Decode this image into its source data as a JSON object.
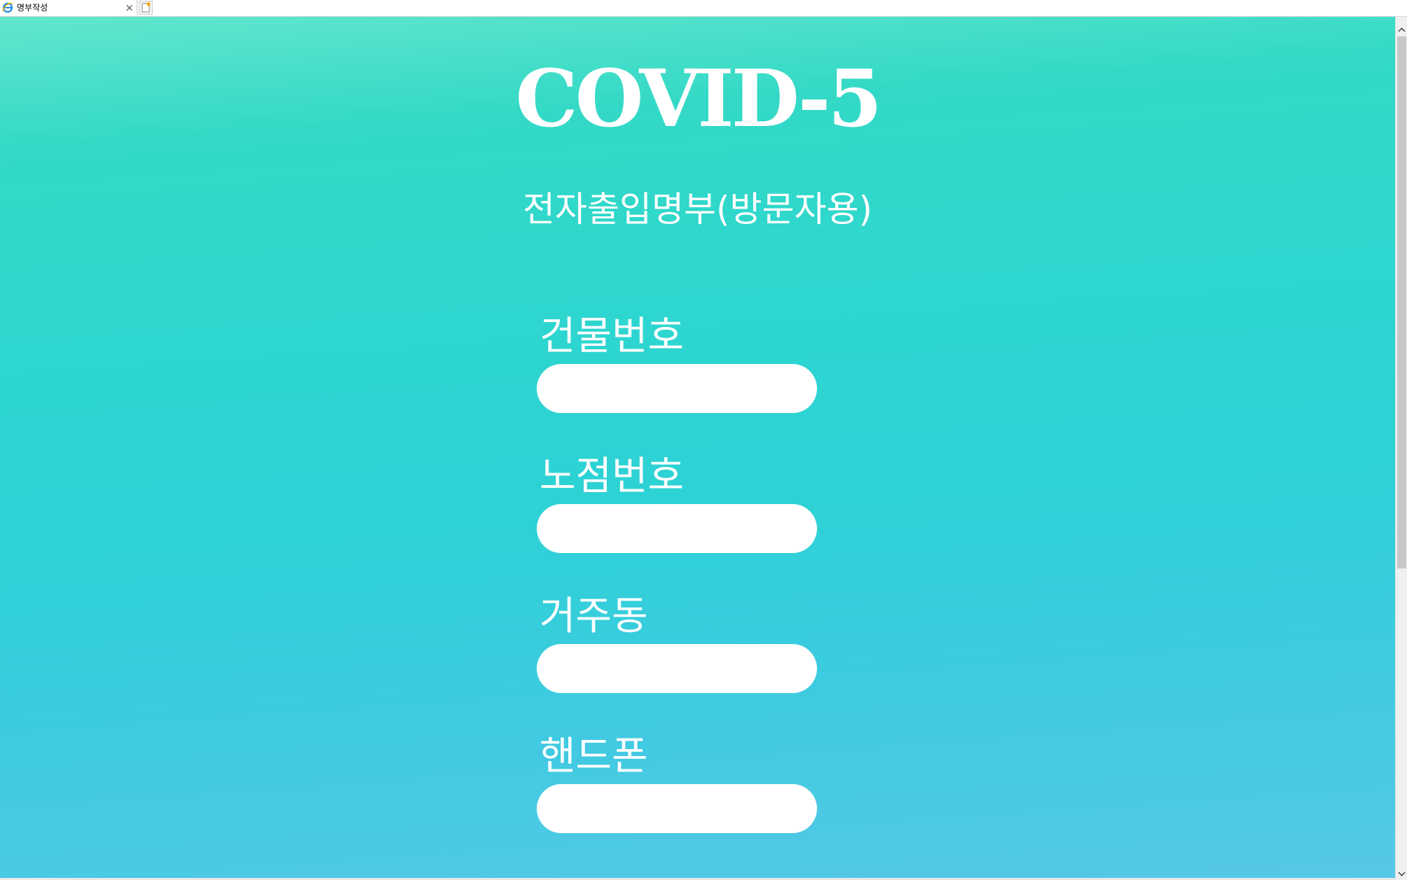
{
  "browser": {
    "tab_title": "명부작성",
    "tab_close_glyph": "×"
  },
  "page": {
    "brand": "COVID-5",
    "subtitle": "전자출입명부(방문자용)",
    "fields": [
      {
        "label": "건물번호",
        "value": "",
        "placeholder": ""
      },
      {
        "label": "노점번호",
        "value": "",
        "placeholder": ""
      },
      {
        "label": "거주동",
        "value": "",
        "placeholder": ""
      },
      {
        "label": "핸드폰",
        "value": "",
        "placeholder": ""
      }
    ]
  },
  "colors": {
    "gradient_top": "#62e6cd",
    "gradient_mid": "#2dd6cf",
    "gradient_bottom": "#56c8e7",
    "text": "#ffffff",
    "input_bg": "#ffffff"
  },
  "icons": {
    "tab_favicon": "internet-explorer-icon",
    "new_tab": "new-tab-icon",
    "scroll_up": "chevron-up-icon",
    "scroll_down": "chevron-down-icon"
  }
}
